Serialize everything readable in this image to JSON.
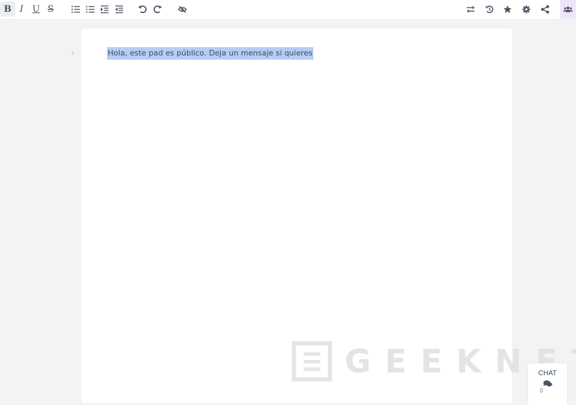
{
  "toolbar": {
    "left": [
      {
        "name": "bold-button",
        "icon": "bold-icon",
        "glyph": "B"
      },
      {
        "name": "italic-button",
        "icon": "italic-icon",
        "glyph": "I"
      },
      {
        "name": "underline-button",
        "icon": "underline-icon",
        "glyph": "U"
      },
      {
        "name": "strikethrough-button",
        "icon": "strikethrough-icon",
        "glyph": "S"
      },
      {
        "name": "ordered-list-button",
        "icon": "ordered-list-icon"
      },
      {
        "name": "unordered-list-button",
        "icon": "unordered-list-icon"
      },
      {
        "name": "indent-button",
        "icon": "indent-icon"
      },
      {
        "name": "outdent-button",
        "icon": "outdent-icon"
      },
      {
        "name": "undo-button",
        "icon": "undo-icon"
      },
      {
        "name": "redo-button",
        "icon": "redo-icon"
      },
      {
        "name": "clear-authorship-button",
        "icon": "eye-slash-icon"
      }
    ],
    "right": [
      {
        "name": "import-export-button",
        "icon": "exchange-icon"
      },
      {
        "name": "timeslider-button",
        "icon": "history-icon"
      },
      {
        "name": "saved-revision-button",
        "icon": "star-icon"
      },
      {
        "name": "settings-button",
        "icon": "gear-icon"
      },
      {
        "name": "share-button",
        "icon": "share-icon"
      },
      {
        "name": "users-button",
        "icon": "users-icon"
      }
    ]
  },
  "editor": {
    "lines": [
      {
        "number": "1",
        "text": "Hola, este pad es público. Deja un mensaje si quieres"
      }
    ]
  },
  "watermark": {
    "text": "GEEKNETIC"
  },
  "chat": {
    "label": "CHAT",
    "icon": "comments-icon",
    "count": "0"
  },
  "colors": {
    "selection": "#b4cdf4",
    "users_active": "#ede5f8",
    "background": "#f2f3f4"
  }
}
